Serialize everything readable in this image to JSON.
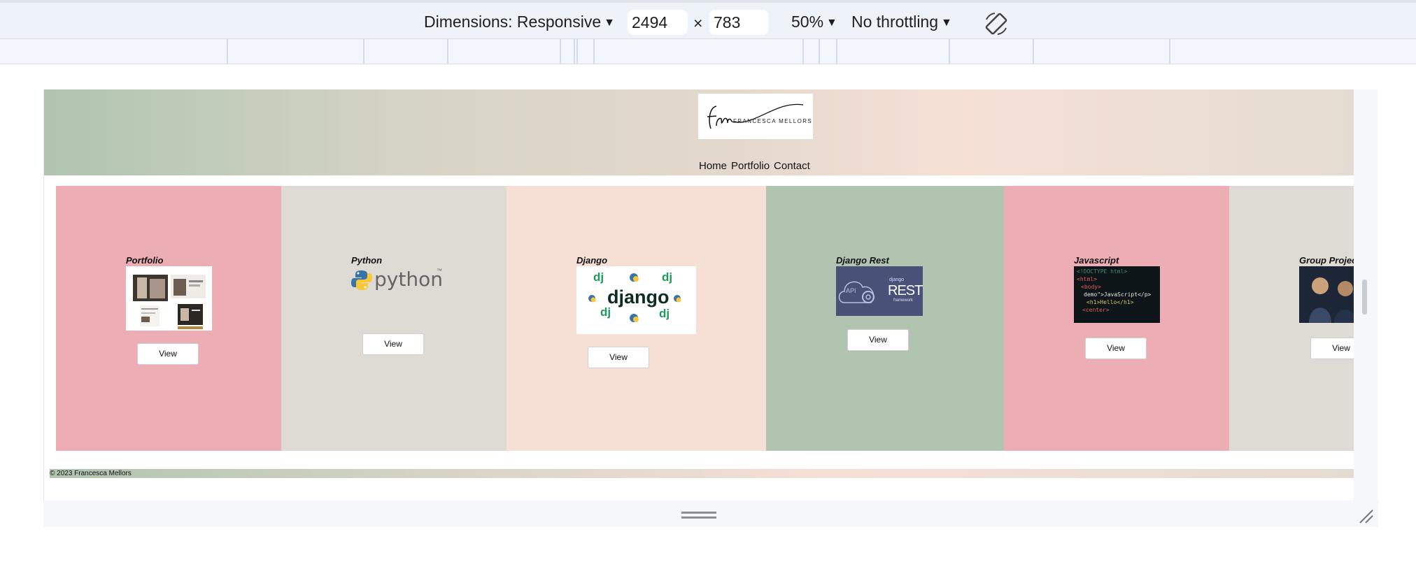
{
  "devtools": {
    "dimensions_label": "Dimensions: Responsive",
    "width_value": "2494",
    "times": "×",
    "height_value": "783",
    "zoom": "50%",
    "throttling": "No throttling",
    "caret": "▼"
  },
  "site": {
    "logo_text": "FRANCESCA MELLORS",
    "nav": [
      "Home",
      "Portfolio",
      "Contact"
    ],
    "cards": [
      {
        "title": "Portfolio",
        "button": "View",
        "color": "#ecaeb4"
      },
      {
        "title": "Python",
        "button": "View",
        "color": "#dedbd4"
      },
      {
        "title": "Django",
        "button": "View",
        "color": "#f6e0d6"
      },
      {
        "title": "Django Rest",
        "button": "View",
        "color": "#b0c4b0"
      },
      {
        "title": "Javascript",
        "button": "View",
        "color": "#ecaeb4"
      },
      {
        "title": "Group Project",
        "button": "View",
        "color": "#dedbd4"
      }
    ],
    "thumbs": {
      "python_word": "python",
      "tm": "™",
      "django_word": "django",
      "dj": "dj",
      "rest_small": "django",
      "rest_word": "REST",
      "rest_sub": "framework",
      "api": "API",
      "js_lines": [
        "<!DOCTYPE html>",
        "<html>",
        "<body>",
        "demo\">JavaScript</p>",
        "<h1>Hello</h1>",
        "<center>"
      ]
    },
    "footer": "© 2023 Francesca Mellors"
  }
}
